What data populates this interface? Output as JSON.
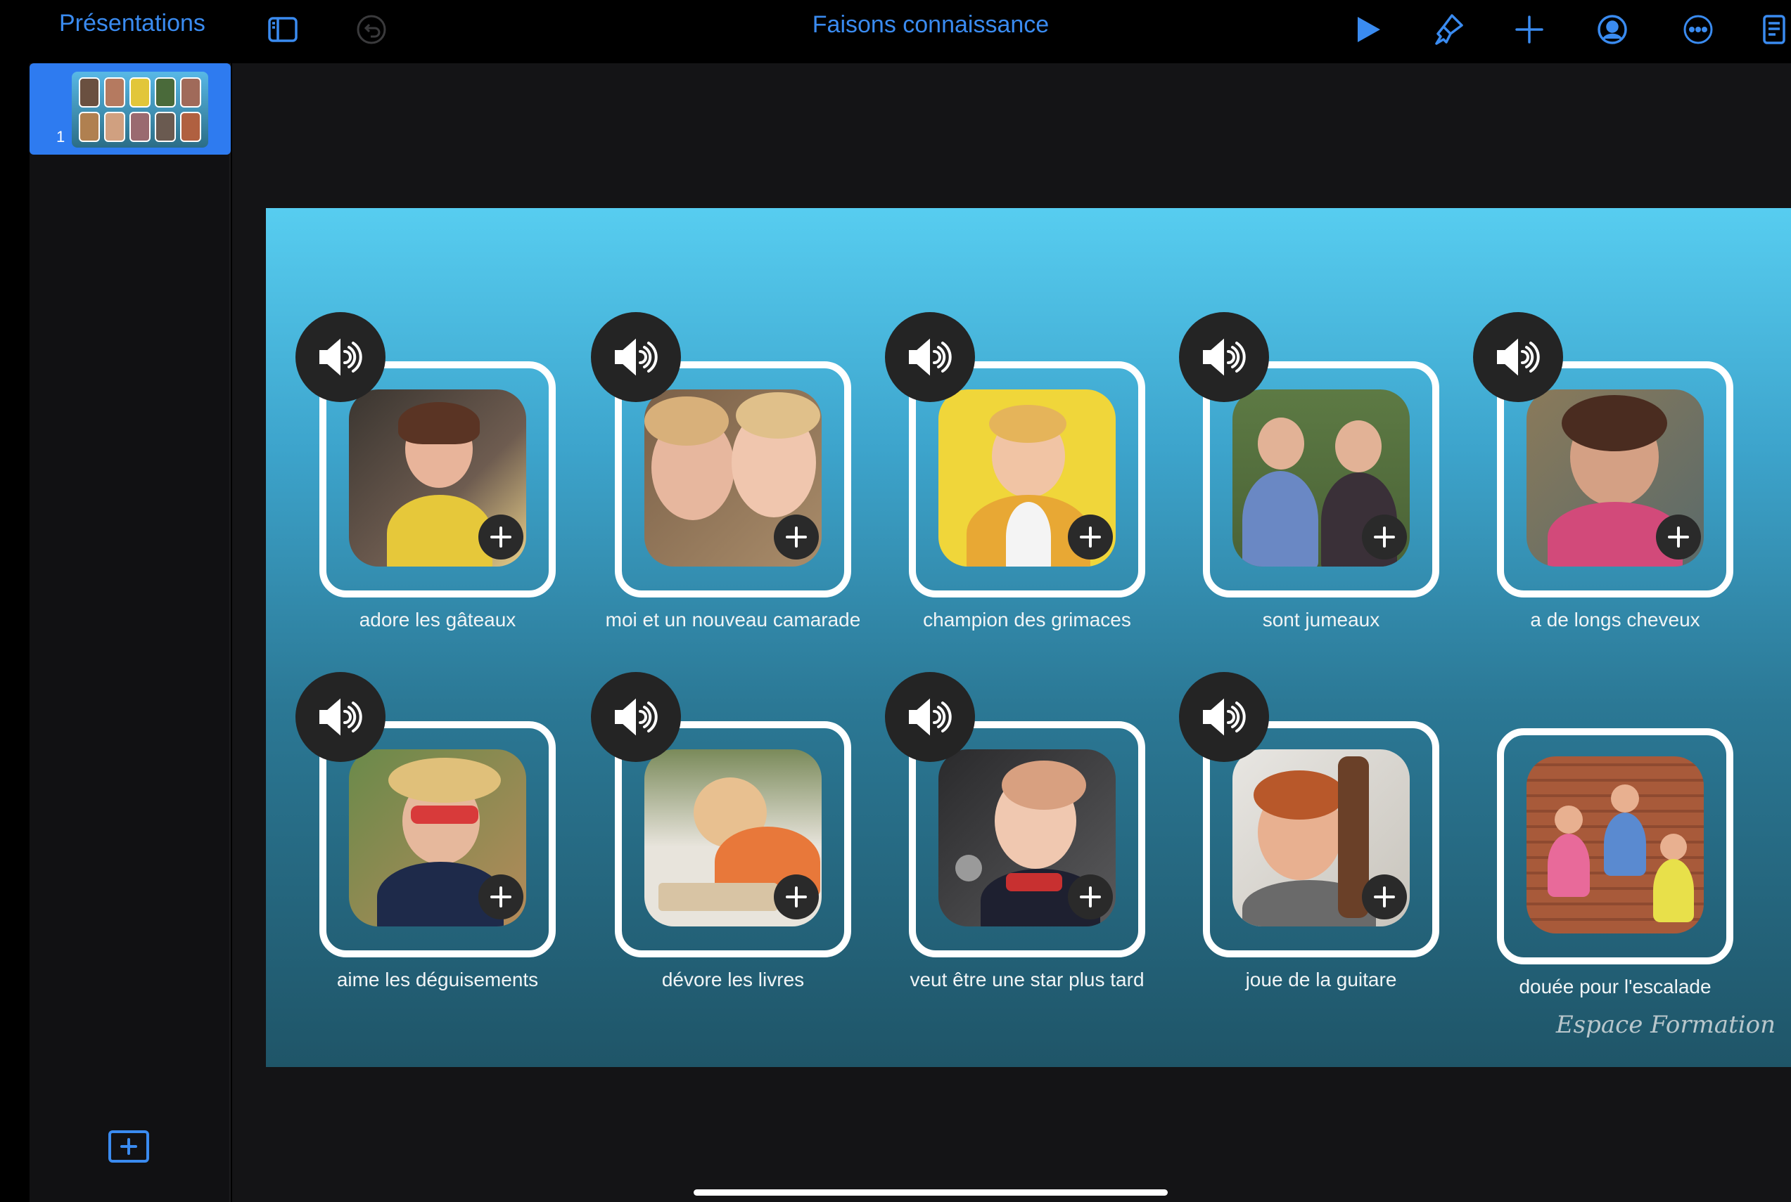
{
  "toolbar": {
    "back_label": "Présentations",
    "title": "Faisons connaissance",
    "icons": [
      "sidebar-toggle-icon",
      "undo-icon",
      "play-icon",
      "brush-icon",
      "plus-icon",
      "collaborate-icon",
      "more-icon",
      "presenter-notes-icon"
    ],
    "accent_color": "#3a8bf0"
  },
  "sidebar": {
    "slides": [
      {
        "number": "1",
        "selected": true
      }
    ],
    "add_slide_icon": "add-slide-icon"
  },
  "slide": {
    "brand": "Espace Formation",
    "cards": [
      {
        "caption": "adore les gâteaux",
        "has_sound": true
      },
      {
        "caption": "moi et un nouveau camarade",
        "has_sound": true
      },
      {
        "caption": "champion des grimaces",
        "has_sound": true
      },
      {
        "caption": "sont jumeaux",
        "has_sound": true
      },
      {
        "caption": "a de longs cheveux",
        "has_sound": true
      },
      {
        "caption": "aime les déguisements",
        "has_sound": true
      },
      {
        "caption": "dévore les livres",
        "has_sound": true
      },
      {
        "caption": "veut être une star plus tard",
        "has_sound": true
      },
      {
        "caption": "joue de la guitare",
        "has_sound": true
      },
      {
        "caption": "douée pour l'escalade",
        "has_sound": false
      }
    ]
  }
}
